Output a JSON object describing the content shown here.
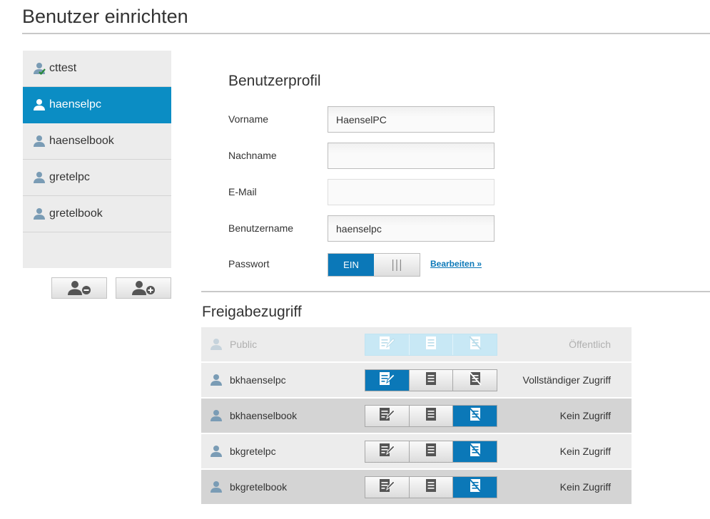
{
  "page": {
    "title": "Benutzer einrichten"
  },
  "users": [
    {
      "name": "cttest",
      "selected": false,
      "checked": true
    },
    {
      "name": "haenselpc",
      "selected": true,
      "checked": false
    },
    {
      "name": "haenselbook",
      "selected": false,
      "checked": false
    },
    {
      "name": "gretelpc",
      "selected": false,
      "checked": false
    },
    {
      "name": "gretelbook",
      "selected": false,
      "checked": false
    }
  ],
  "list_buttons": {
    "remove_icon": "user-minus-icon",
    "add_icon": "user-plus-icon"
  },
  "profile": {
    "title": "Benutzerprofil",
    "vorname_label": "Vorname",
    "vorname_value": "HaenselPC",
    "nachname_label": "Nachname",
    "nachname_value": "",
    "email_label": "E-Mail",
    "email_value": "",
    "benutzername_label": "Benutzername",
    "benutzername_value": "haenselpc",
    "passwort_label": "Passwort",
    "passwort_toggle": "EIN",
    "edit_link": "Bearbeiten »"
  },
  "shares": {
    "title": "Freigabezugriff",
    "rows": [
      {
        "name": "Public",
        "status": "Öffentlich",
        "active": 2,
        "disabled": true
      },
      {
        "name": "bkhaenselpc",
        "status": "Vollständiger Zugriff",
        "active": 0,
        "disabled": false
      },
      {
        "name": "bkhaenselbook",
        "status": "Kein Zugriff",
        "active": 2,
        "disabled": false
      },
      {
        "name": "bkgretelpc",
        "status": "Kein Zugriff",
        "active": 2,
        "disabled": false
      },
      {
        "name": "bkgretelbook",
        "status": "Kein Zugriff",
        "active": 2,
        "disabled": false
      }
    ]
  },
  "colors": {
    "accent": "#0b78b8",
    "selected_row": "#0b8dc4"
  }
}
